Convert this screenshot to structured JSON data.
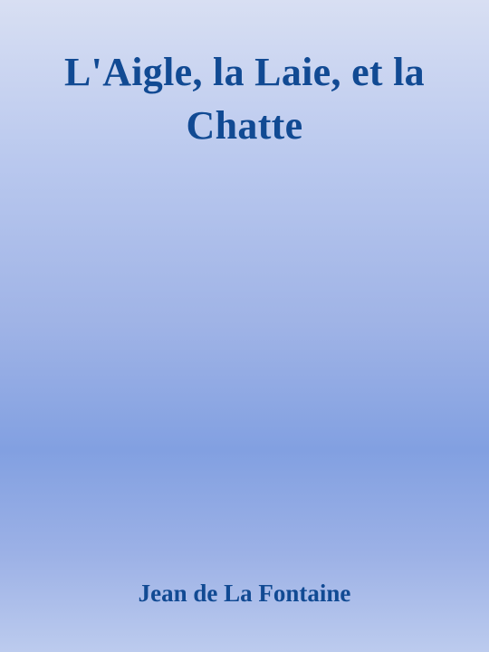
{
  "cover": {
    "title": "L'Aigle, la Laie, et la Chatte",
    "author": "Jean de La Fontaine"
  }
}
